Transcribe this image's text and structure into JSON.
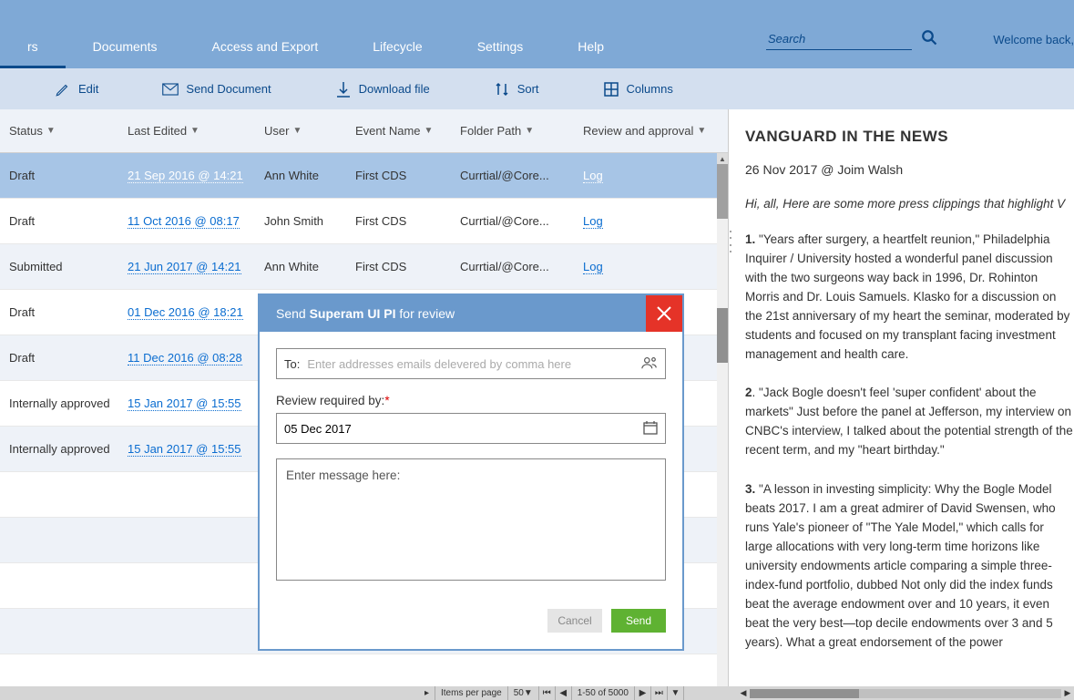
{
  "nav": {
    "tabs": [
      "rs",
      "Documents",
      "Access and Export",
      "Lifecycle",
      "Settings",
      "Help"
    ],
    "activeIndex": 0,
    "searchPlaceholder": "Search",
    "welcome": "Welcome back,"
  },
  "toolbar": {
    "items": [
      {
        "label": "Edit",
        "icon": "pencil"
      },
      {
        "label": "Send Document",
        "icon": "envelope"
      },
      {
        "label": "Download file",
        "icon": "download"
      },
      {
        "label": "Sort",
        "icon": "sort"
      },
      {
        "label": "Columns",
        "icon": "grid"
      }
    ]
  },
  "table": {
    "headers": [
      "Status",
      "Last Edited",
      "User",
      "Event Name",
      "Folder Path",
      "Review and approval"
    ],
    "rows": [
      {
        "status": "Draft",
        "edited": "21 Sep 2016 @ 14:21",
        "user": "Ann White",
        "event": "First CDS",
        "folder": "Currtial/@Core...",
        "review": "Log",
        "selected": true
      },
      {
        "status": "Draft",
        "edited": "11 Oct 2016 @ 08:17",
        "user": "John Smith",
        "event": "First CDS",
        "folder": "Currtial/@Core...",
        "review": "Log"
      },
      {
        "status": "Submitted",
        "edited": "21 Jun 2017 @ 14:21",
        "user": "Ann White",
        "event": "First CDS",
        "folder": "Currtial/@Core...",
        "review": "Log"
      },
      {
        "status": "Draft",
        "edited": "01 Dec 2016 @ 18:21",
        "user": "",
        "event": "",
        "folder": "",
        "review": ""
      },
      {
        "status": "Draft",
        "edited": "11 Dec 2016 @ 08:28",
        "user": "",
        "event": "",
        "folder": "",
        "review": ""
      },
      {
        "status": "Internally approved",
        "edited": "15 Jan 2017 @ 15:55",
        "user": "",
        "event": "",
        "folder": "",
        "review": ""
      },
      {
        "status": "Internally approved",
        "edited": "15 Jan 2017 @ 15:55",
        "user": "",
        "event": "",
        "folder": "",
        "review": ""
      },
      {
        "status": "",
        "edited": "",
        "user": "",
        "event": "",
        "folder": "",
        "review": "",
        "alt": true
      },
      {
        "status": "",
        "edited": "",
        "user": "",
        "event": "",
        "folder": "",
        "review": ""
      },
      {
        "status": "",
        "edited": "",
        "user": "",
        "event": "",
        "folder": "",
        "review": "",
        "alt": true
      },
      {
        "status": "",
        "edited": "",
        "user": "",
        "event": "",
        "folder": "",
        "review": ""
      }
    ]
  },
  "detail": {
    "title": "VANGUARD IN THE NEWS",
    "meta": "26 Nov 2017 @ Joim Walsh",
    "intro": "Hi, all, Here are some more press clippings that highlight V",
    "paras": [
      "\"Years after surgery, a heartfelt reunion,\" Philadelphia Inquirer / University hosted a wonderful panel discussion with the two surgeons way back in 1996, Dr. Rohinton Morris and Dr. Louis Samuels. Klasko for a discussion on the 21st anniversary of my heart the seminar, moderated by students and focused on my transplant facing investment management and health care.",
      "\"Jack Bogle doesn't feel 'super confident' about the markets\" Just before the panel at Jefferson, my interview on CNBC's interview, I talked about the potential strength of the recent term, and my \"heart birthday.\"",
      "\"A lesson in investing simplicity: Why the Bogle Model beats 2017. I am a great admirer of David Swensen, who runs Yale's pioneer of \"The Yale Model,\" which calls for large allocations with very long-term time horizons like university endowments article comparing a simple three-index-fund portfolio, dubbed Not only did the index funds beat the average endowment over and 10 years, it even beat the very best—top decile endowments over 3 and 5 years). What a great endorsement of the power"
    ]
  },
  "modal": {
    "titlePrefix": "Send ",
    "titleName": "Superam UI PI",
    "titleSuffix": " for review",
    "toLabel": "To:",
    "toPlaceholder": "Enter addresses emails delevered by comma here",
    "reviewLabel": "Review required by:",
    "reviewDate": "05 Dec 2017",
    "msgPlaceholder": "Enter message here:",
    "cancel": "Cancel",
    "send": "Send"
  },
  "pager": {
    "itemsLabel": "Items per page",
    "pageSize": "50",
    "range": "1-50 of 5000"
  }
}
